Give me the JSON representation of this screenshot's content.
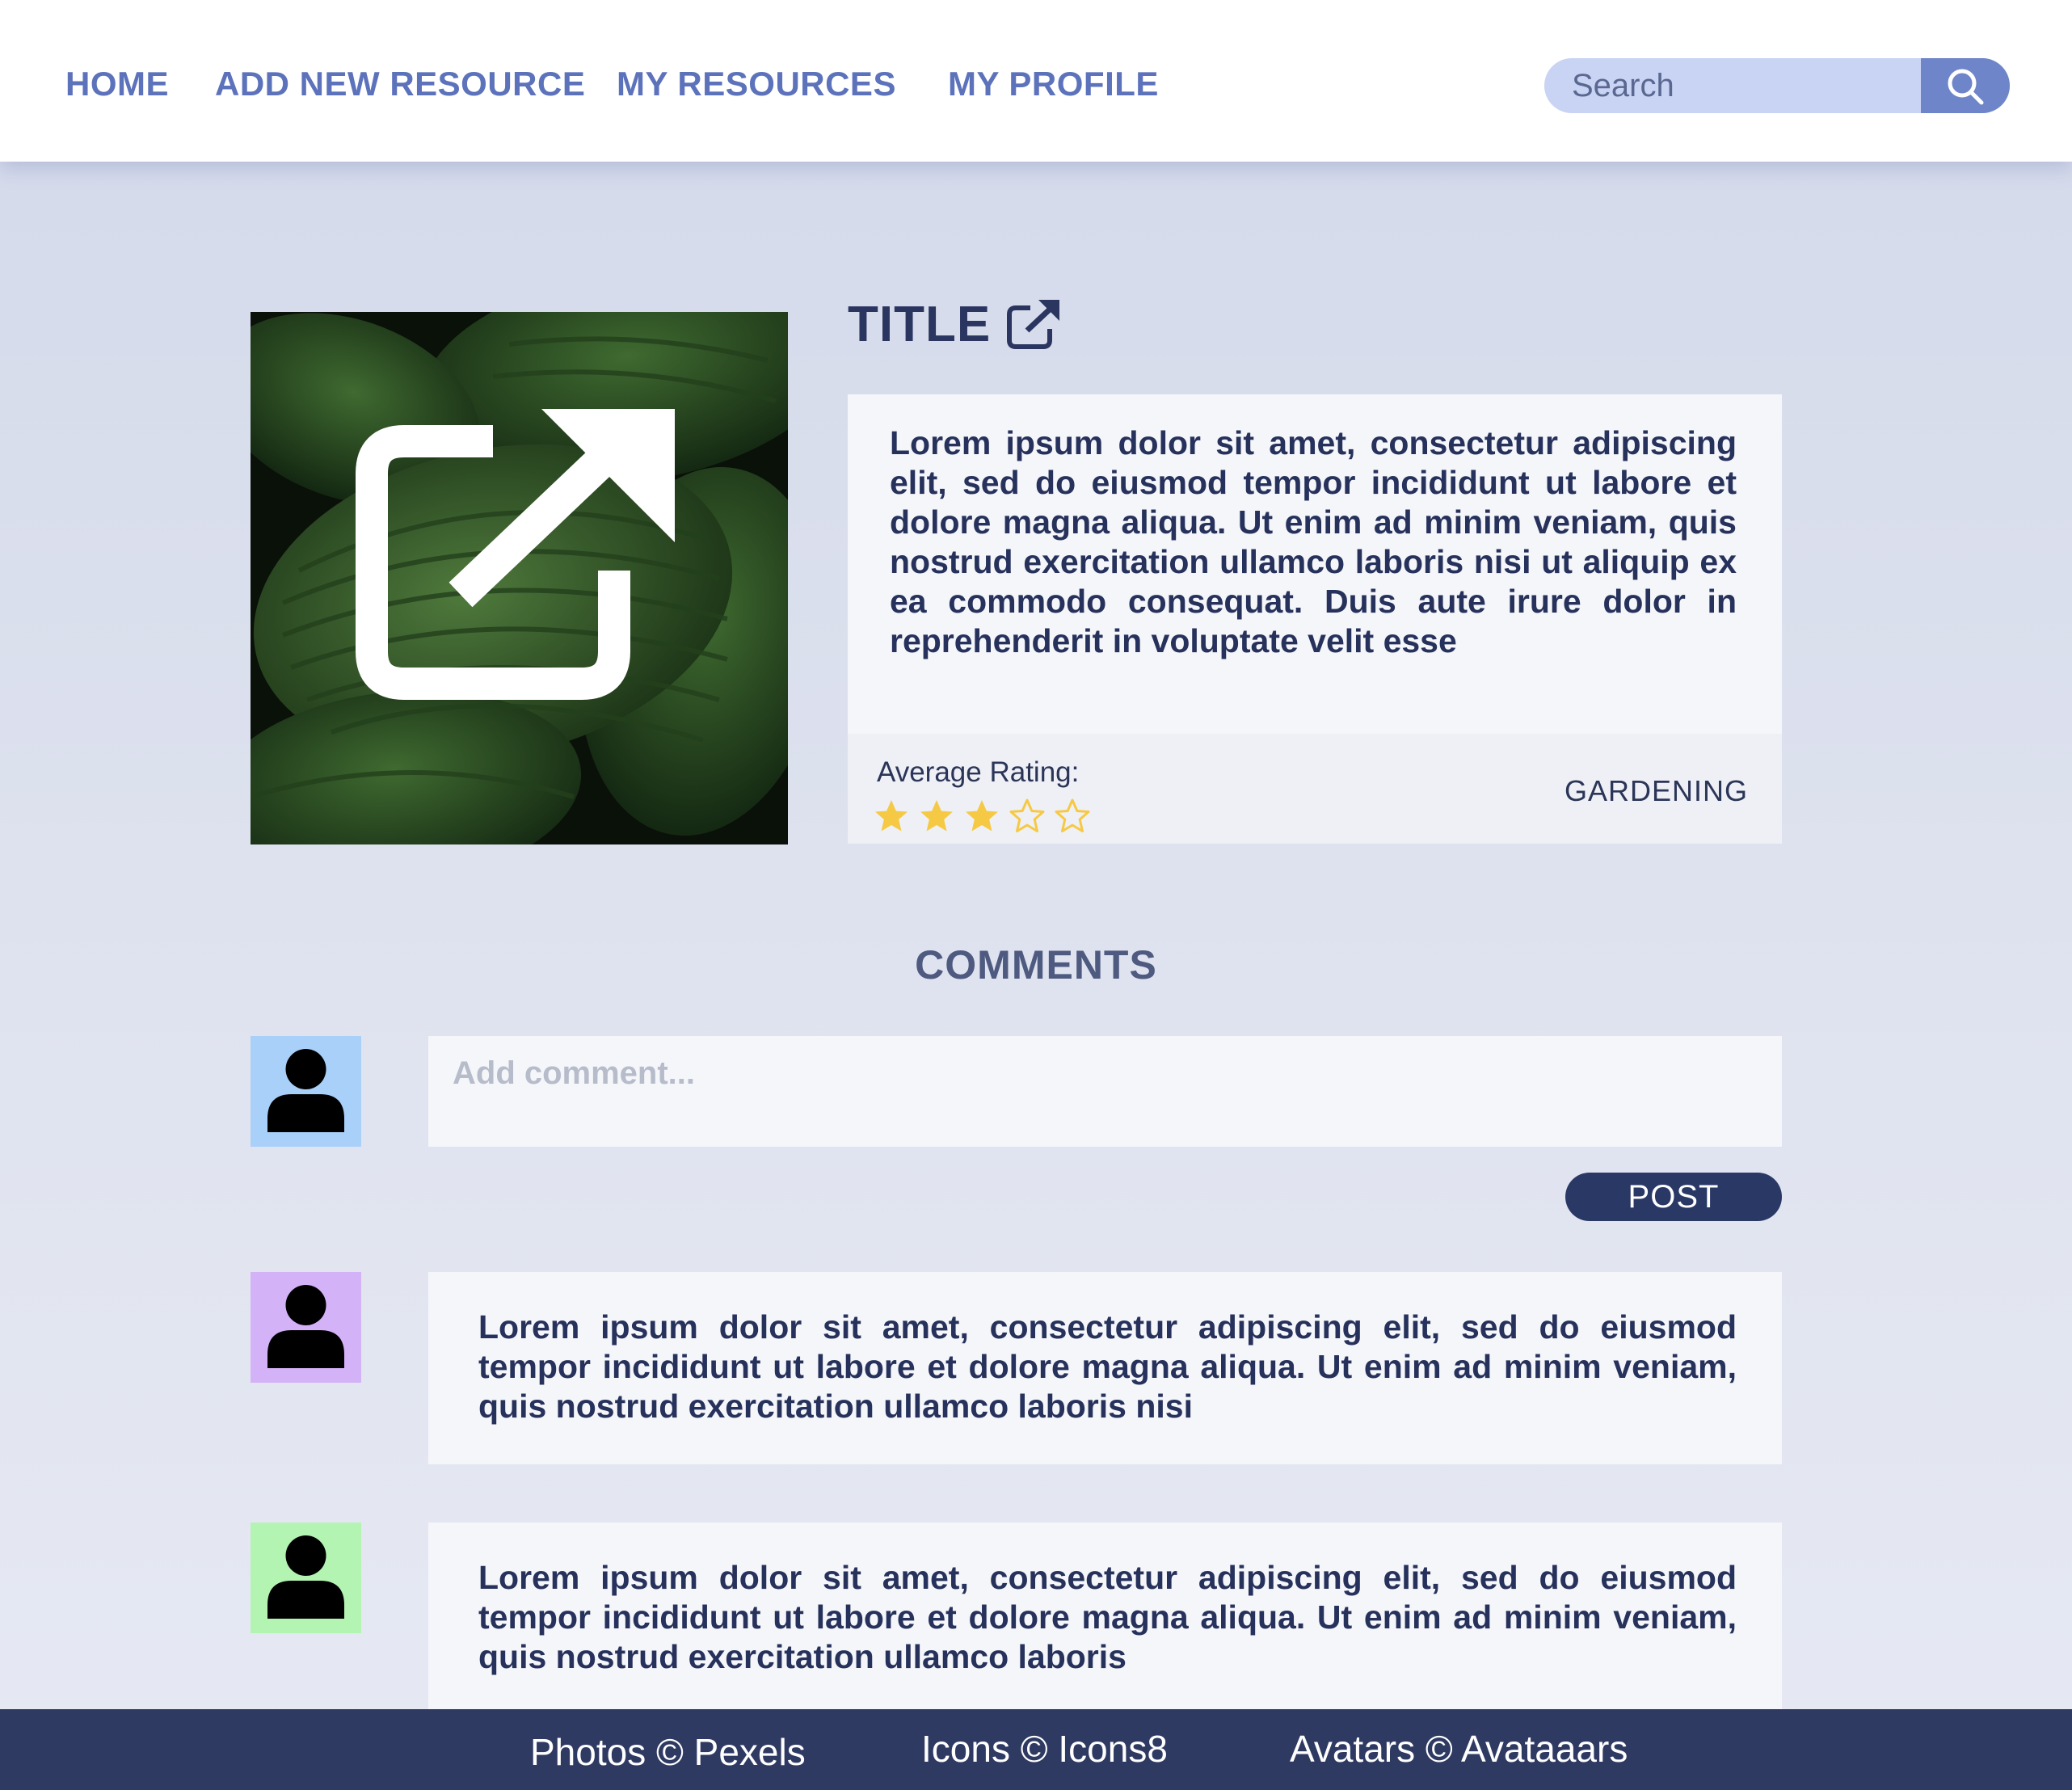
{
  "nav": {
    "items": [
      "HOME",
      "ADD NEW RESOURCE",
      "MY RESOURCES",
      "MY PROFILE"
    ],
    "search_placeholder": "Search"
  },
  "resource": {
    "title": "TITLE",
    "description": "Lorem ipsum dolor sit amet, consectetur adipiscing elit, sed do eiusmod tempor incididunt ut labore et dolore magna aliqua. Ut enim ad minim veniam, quis nostrud exercitation ullamco laboris nisi ut aliquip ex ea commodo consequat. Duis aute irure dolor in reprehenderit in voluptate velit esse",
    "rating_label": "Average Rating:",
    "rating": 3,
    "rating_max": 5,
    "category": "GARDENING",
    "colors": {
      "star_filled": "#f6c945",
      "star_empty": "#f6c945"
    }
  },
  "comments": {
    "heading": "COMMENTS",
    "input_placeholder": "Add comment...",
    "post_label": "POST",
    "current_user_avatar_color": "#a9d0f9",
    "list": [
      {
        "avatar_color": "#d4b2f7",
        "text": "Lorem ipsum dolor sit amet, consectetur adipiscing elit, sed do eiusmod tempor incididunt ut labore et dolore magna aliqua. Ut enim ad minim veniam, quis nostrud exercitation ullamco laboris nisi"
      },
      {
        "avatar_color": "#b4f4b2",
        "text": "Lorem ipsum dolor sit amet, consectetur adipiscing elit, sed do eiusmod tempor incididunt ut labore et dolore magna aliqua. Ut enim ad minim veniam, quis nostrud exercitation ullamco laboris"
      }
    ]
  },
  "footer": {
    "items": [
      "Photos © Pexels",
      "Icons © Icons8",
      "Avatars © Avataaars"
    ]
  }
}
